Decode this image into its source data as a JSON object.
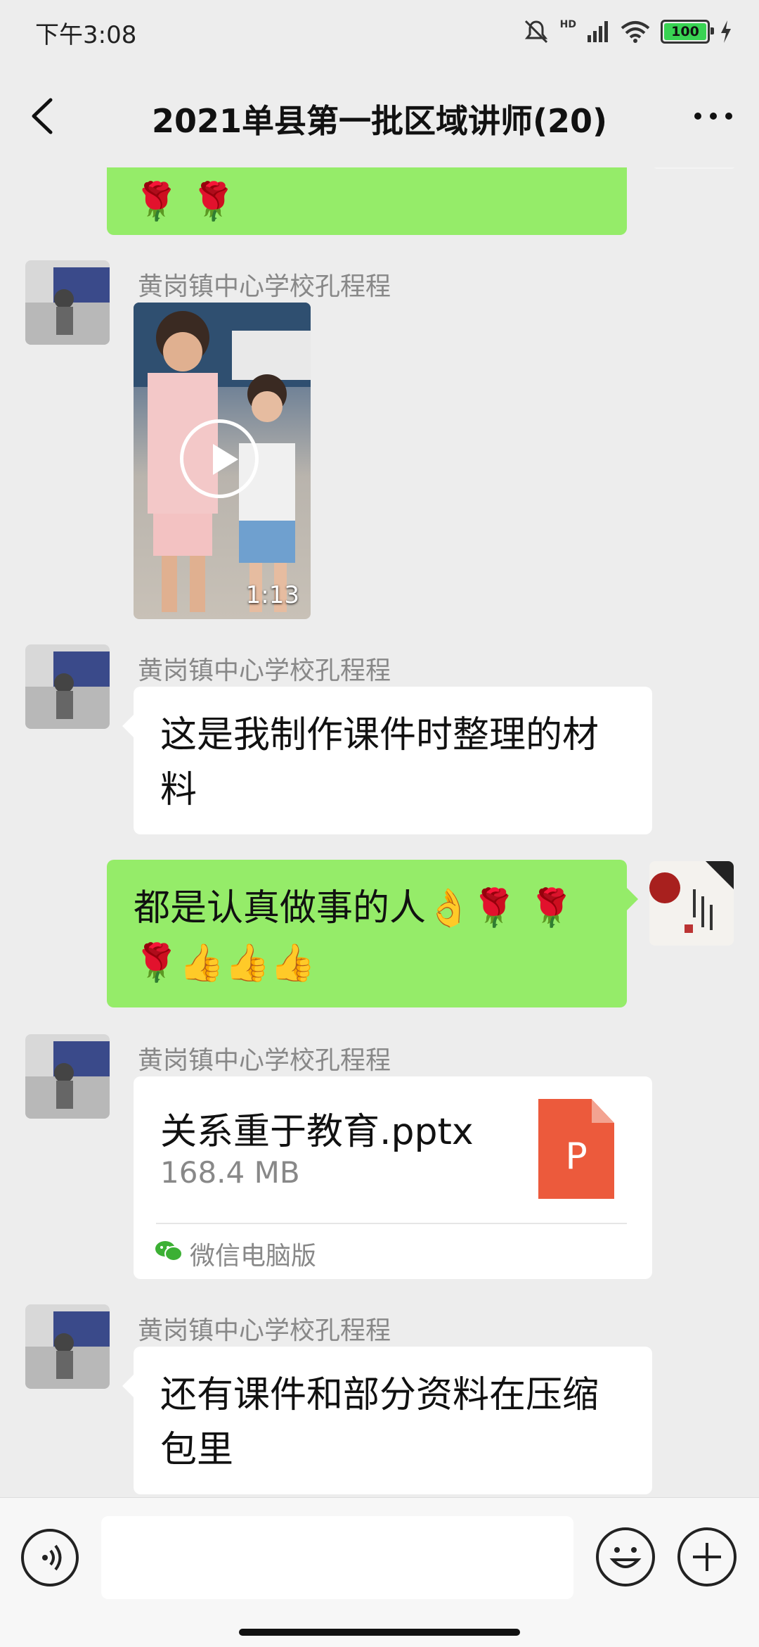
{
  "status_bar": {
    "time": "下午3:08",
    "battery": "100",
    "network": "HD"
  },
  "header": {
    "title": "2021单县第一批区域讲师(20)"
  },
  "messages": {
    "top_partial": {
      "text": "🌹 🌹"
    },
    "video_msg": {
      "sender": "黄岗镇中心学校孔程程",
      "duration": "1:13"
    },
    "text_msg_1": {
      "sender": "黄岗镇中心学校孔程程",
      "text": "这是我制作课件时整理的材料"
    },
    "own_msg": {
      "text": "都是认真做事的人👌🌹 🌹 🌹👍👍👍"
    },
    "file_msg": {
      "sender": "黄岗镇中心学校孔程程",
      "file_name": "关系重于教育.pptx",
      "file_size": "168.4 MB",
      "file_type_letter": "P",
      "source": "微信电脑版"
    },
    "text_msg_2": {
      "sender": "黄岗镇中心学校孔程程",
      "text": "还有课件和部分资料在压缩包里"
    }
  },
  "input": {
    "placeholder": ""
  },
  "colors": {
    "bubble_green": "#95ec69",
    "background": "#ededed",
    "ppt_icon": "#ec5a3c"
  }
}
